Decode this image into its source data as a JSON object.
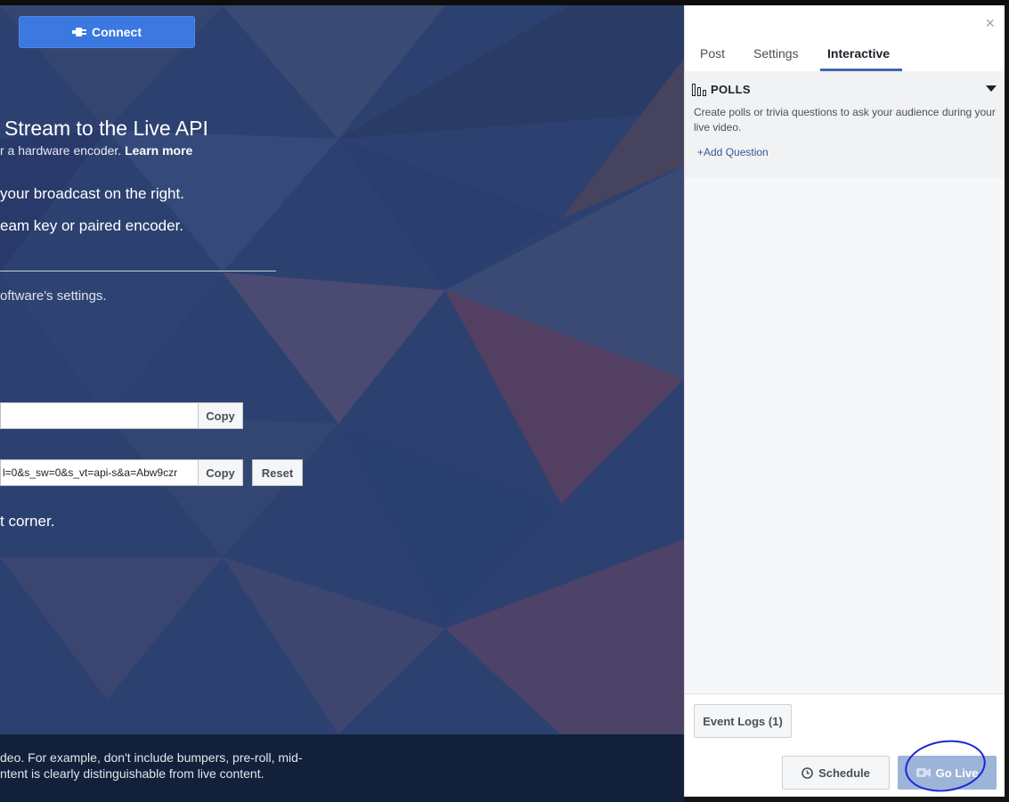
{
  "stage": {
    "connect_label": "Connect",
    "heading": "Stream to the Live API",
    "sub_text": "r a hardware encoder.",
    "sub_link": "Learn more",
    "step1": "your broadcast on the right.",
    "step2": "eam key or paired encoder.",
    "software_text": "oftware's settings.",
    "server_url_value": "",
    "stream_key_value": "l=0&s_sw=0&s_vt=api-s&a=Abw9czr",
    "copy_label": "Copy",
    "reset_label": "Reset",
    "corner_text": "t corner.",
    "footer_line1": "deo. For example, don't include bumpers, pre-roll, mid-",
    "footer_line2": "ntent is clearly distinguishable from live content."
  },
  "panel": {
    "close": "×",
    "tabs": [
      {
        "label": "Post"
      },
      {
        "label": "Settings"
      },
      {
        "label": "Interactive"
      }
    ],
    "polls": {
      "title": "POLLS",
      "description": "Create polls or trivia questions to ask your audience during your live video.",
      "add_question": "+Add Question"
    },
    "event_logs": "Event Logs (1)",
    "schedule": "Schedule",
    "go_live": "Go Live"
  },
  "colors": {
    "accent": "#4267b2",
    "connect_button": "#3b78e0",
    "go_live_disabled": "#9cb4d8",
    "annotation_circle": "#1a28d6"
  }
}
